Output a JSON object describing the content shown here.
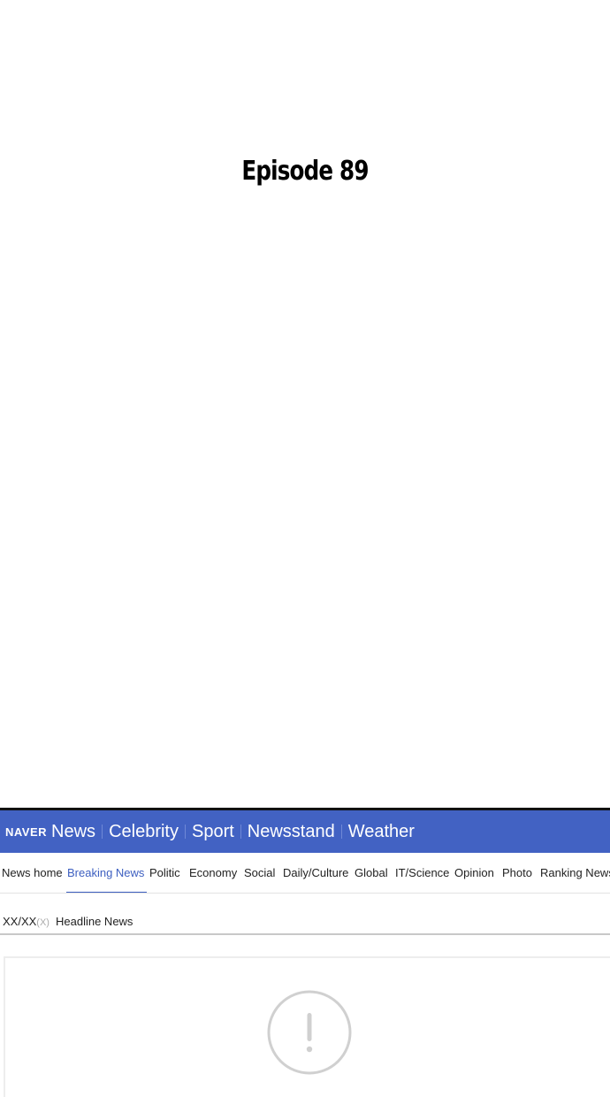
{
  "episode": {
    "title": "Episode 89"
  },
  "news": {
    "logo": "NAVER",
    "top_nav": [
      "News",
      "Celebrity",
      "Sport",
      "Newsstand",
      "Weather"
    ],
    "sub_nav": [
      "News home",
      "Breaking News",
      "Politic",
      "Economy",
      "Social",
      "Daily/Culture",
      "Global",
      "IT/Science",
      "Opinion",
      "Photo",
      "Ranking News"
    ],
    "active_sub_nav": "Breaking News",
    "date": "XX/XX",
    "date_suffix": "(X)",
    "headline_label": "Headline News",
    "alert_icon": "exclamation-circle-icon",
    "colors": {
      "topbar": "#4262c3",
      "active": "#3d5fc0",
      "icon": "#d0d0d0"
    }
  }
}
